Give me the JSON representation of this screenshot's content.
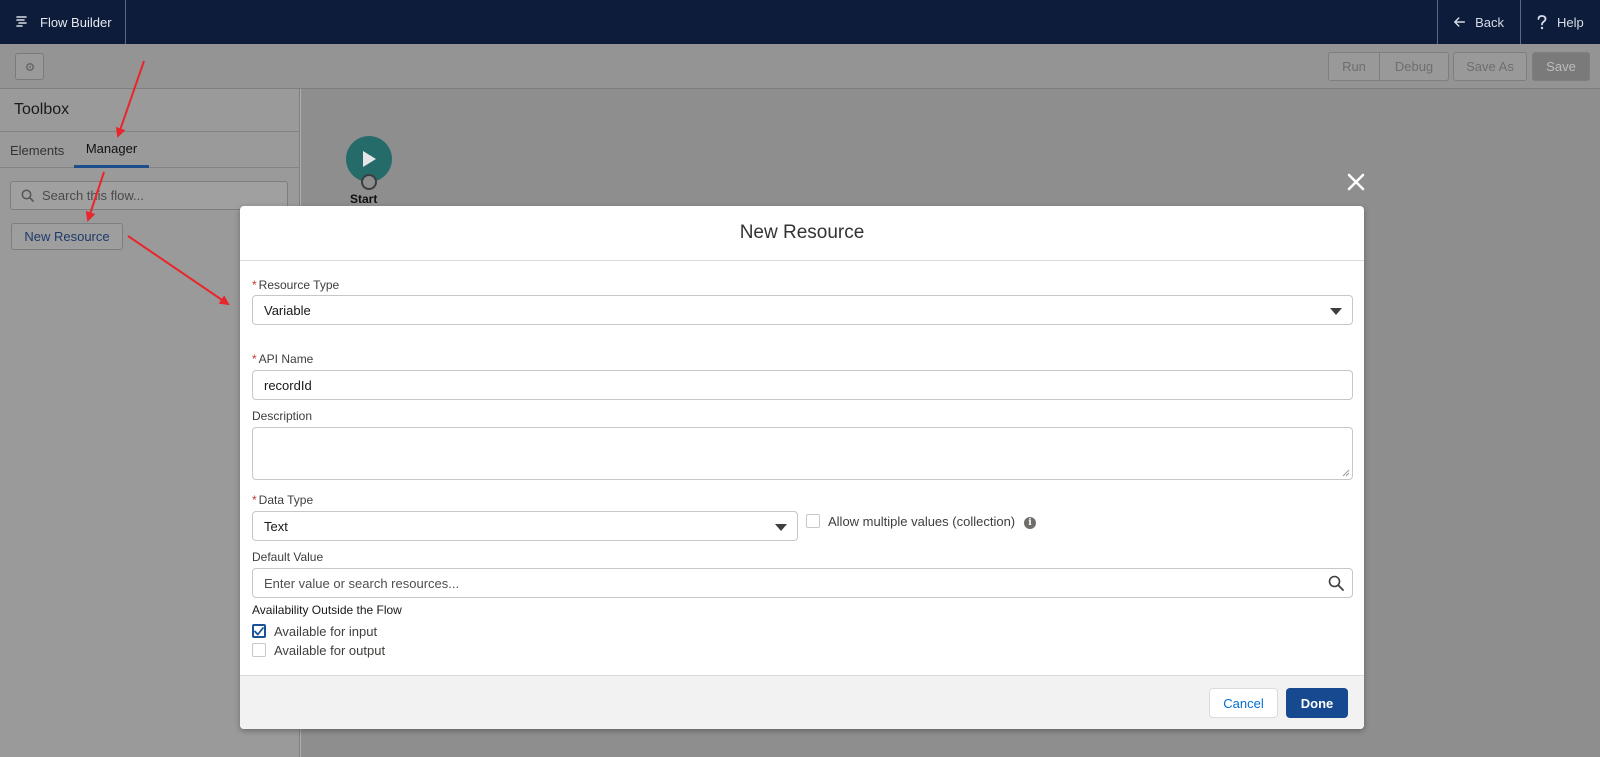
{
  "app": {
    "title": "Flow Builder",
    "back_label": "Back",
    "help_label": "Help"
  },
  "toolbar": {
    "run_label": "Run",
    "debug_label": "Debug",
    "save_as_label": "Save As",
    "save_label": "Save"
  },
  "toolbox": {
    "title": "Toolbox",
    "tabs": [
      {
        "label": "Elements",
        "active": false
      },
      {
        "label": "Manager",
        "active": true
      }
    ],
    "search_placeholder": "Search this flow...",
    "new_resource_label": "New Resource"
  },
  "canvas": {
    "start_label": "Start",
    "start_color": "#256b6a"
  },
  "modal": {
    "title": "New Resource",
    "resource_type": {
      "label": "Resource Type",
      "required": true,
      "value": "Variable"
    },
    "api_name": {
      "label": "API Name",
      "required": true,
      "value": "recordId"
    },
    "description": {
      "label": "Description",
      "value": ""
    },
    "data_type": {
      "label": "Data Type",
      "required": true,
      "value": "Text"
    },
    "allow_multiple": {
      "label": "Allow multiple values (collection)",
      "checked": false
    },
    "default_value": {
      "label": "Default Value",
      "placeholder": "Enter value or search resources..."
    },
    "availability": {
      "title": "Availability Outside the Flow",
      "input": {
        "label": "Available for input",
        "checked": true
      },
      "output": {
        "label": "Available for output",
        "checked": false
      }
    },
    "cancel_label": "Cancel",
    "done_label": "Done"
  },
  "colors": {
    "nav_bg": "#0c1c3a",
    "brand_blue": "#16498f",
    "annotation_red": "#e8262b"
  }
}
